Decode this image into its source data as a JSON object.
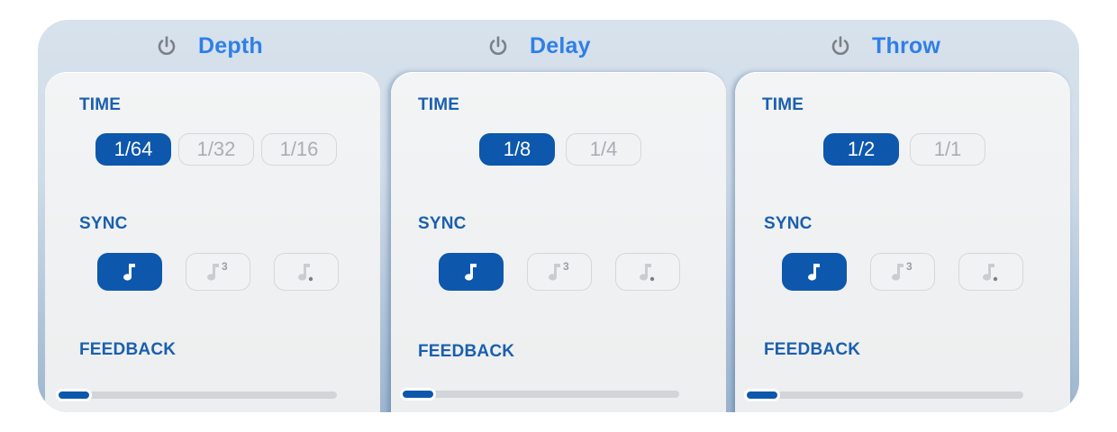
{
  "panels": [
    {
      "title": "Depth",
      "power_icon": "power-icon",
      "time_label": "TIME",
      "time_options": [
        "1/64",
        "1/32",
        "1/16"
      ],
      "time_selected": "1/64",
      "sync_label": "SYNC",
      "sync_options": [
        "note-icon",
        "triplet-note-icon",
        "dotted-note-icon"
      ],
      "sync_triplet_mark": "3",
      "sync_selected": "note-icon",
      "feedback_label": "FEEDBACK",
      "feedback_level": 0.1
    },
    {
      "title": "Delay",
      "power_icon": "power-icon",
      "time_label": "TIME",
      "time_options": [
        "1/8",
        "1/4"
      ],
      "time_selected": "1/8",
      "sync_label": "SYNC",
      "sync_options": [
        "note-icon",
        "triplet-note-icon",
        "dotted-note-icon"
      ],
      "sync_triplet_mark": "3",
      "sync_selected": "note-icon",
      "feedback_label": "FEEDBACK",
      "feedback_level": 0.1
    },
    {
      "title": "Throw",
      "power_icon": "power-icon",
      "time_label": "TIME",
      "time_options": [
        "1/2",
        "1/1"
      ],
      "time_selected": "1/2",
      "sync_label": "SYNC",
      "sync_options": [
        "note-icon",
        "triplet-note-icon",
        "dotted-note-icon"
      ],
      "sync_triplet_mark": "3",
      "sync_selected": "note-icon",
      "feedback_label": "FEEDBACK",
      "feedback_level": 0.1
    }
  ],
  "colors": {
    "accent": "#0d57ad",
    "title": "#2f7fe6",
    "label": "#1a5fae",
    "inactive_text": "#a9aeb4",
    "power_icon": "#7b8087"
  }
}
